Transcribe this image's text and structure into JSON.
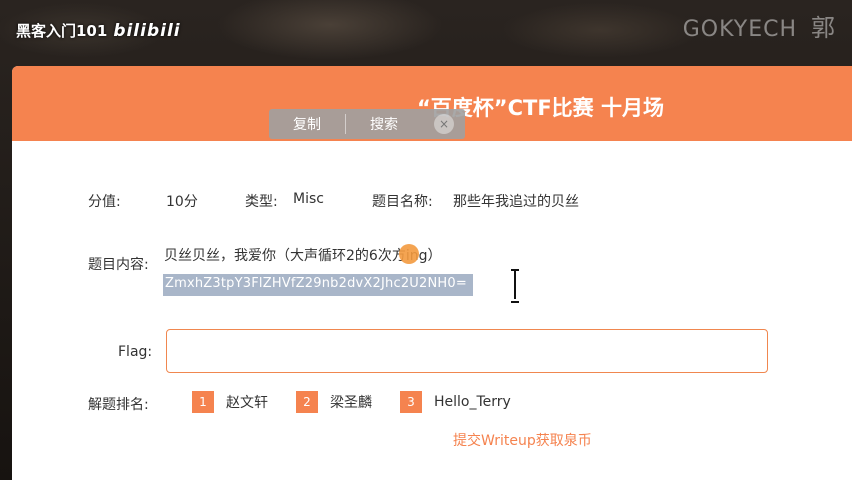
{
  "overlay": {
    "channel": "黑客入门101",
    "bili_logo": "bilibili",
    "watermark": "GOKYECH",
    "watermark_char": "郭"
  },
  "header": {
    "title": "“百度杯”CTF比赛 十月场"
  },
  "popup": {
    "copy_label": "复制",
    "search_label": "搜索",
    "close_label": "×"
  },
  "meta": {
    "score_label": "分值:",
    "score_value": "10分",
    "type_label": "类型:",
    "type_value": "Misc",
    "name_label": "题目名称:",
    "name_value": "那些年我追过的贝丝"
  },
  "content": {
    "label": "题目内容:",
    "text": "贝丝贝丝，我爱你（大声循环2的6次方ing）",
    "selected_text": "ZmxhZ3tpY3FlZHVfZ29nb2dvX2Jhc2U2NH0="
  },
  "flag": {
    "label": "Flag:",
    "value": "",
    "placeholder": ""
  },
  "ranking": {
    "label": "解题排名:",
    "entries": [
      {
        "rank": "1",
        "name": "赵文轩"
      },
      {
        "rank": "2",
        "name": "梁圣麟"
      },
      {
        "rank": "3",
        "name": "Hello_Terry"
      }
    ]
  },
  "writeup_link": "提交Writeup获取泉币",
  "colors": {
    "accent": "#f5834f",
    "selection": "#a9b6c9"
  }
}
